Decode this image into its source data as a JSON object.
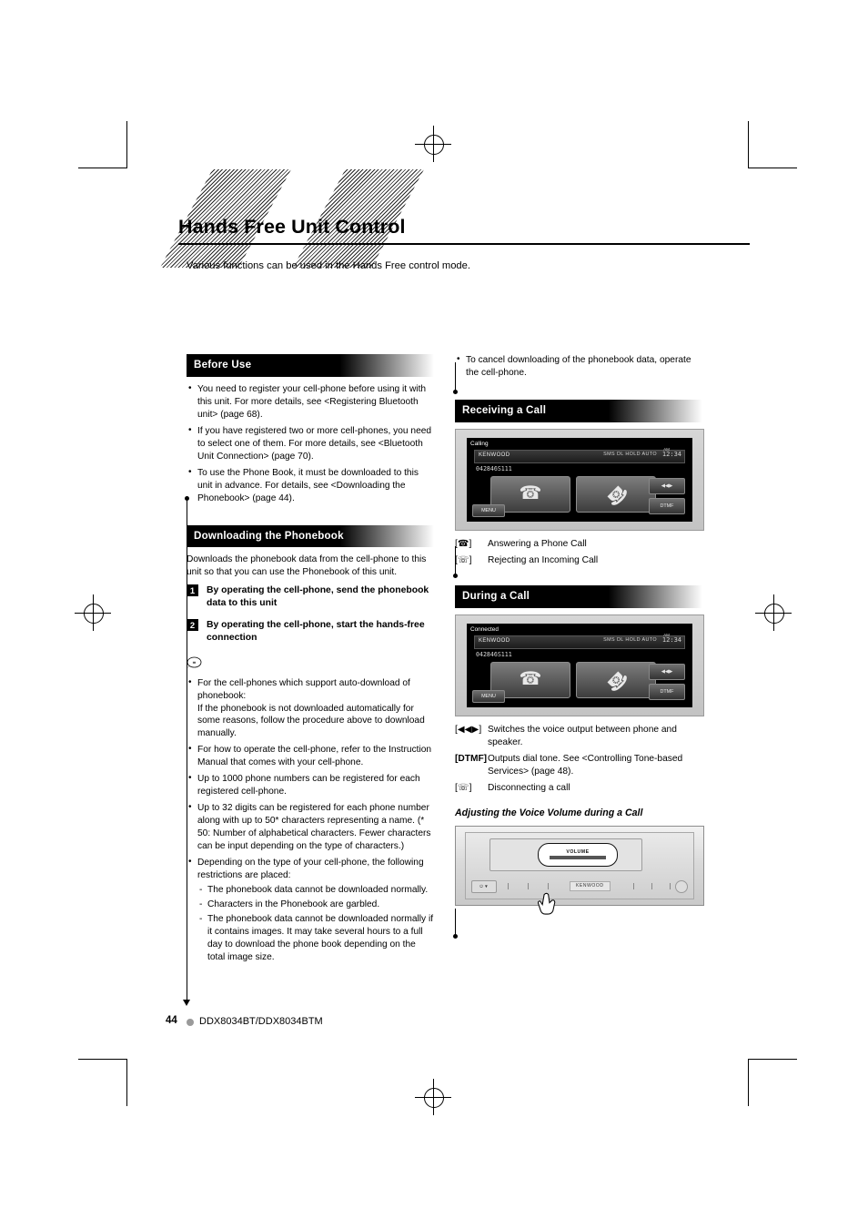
{
  "document": {
    "title": "Hands Free Unit Control",
    "subtitle": "Various functions can be used in the Hands Free control mode.",
    "footer_page": "44",
    "footer_model": "DDX8034BT/DDX8034BTM"
  },
  "sections": {
    "before_use": {
      "heading": "Before Use",
      "bullets": [
        "You need to register your cell-phone before using it with this unit. For more details, see <Registering Bluetooth unit> (page 68).",
        "If you have registered two or more cell-phones, you need to select one of them. For more details, see <Bluetooth Unit Connection> (page 70).",
        "To use the Phone Book, it must be downloaded to this unit in advance. For details, see <Downloading the Phonebook> (page 44)."
      ]
    },
    "downloading_phonebook": {
      "heading": "Downloading the Phonebook",
      "intro": "Downloads the phonebook data from the cell-phone to this unit so that you can use the Phonebook of this unit.",
      "steps": [
        {
          "num": "1",
          "text": "By operating the cell-phone, send the phonebook data to this unit"
        },
        {
          "num": "2",
          "text": "By operating the cell-phone, start the hands-free connection"
        }
      ],
      "note_bullets": [
        "For the cell-phones which support auto-download of phonebook:\nIf the phonebook is not downloaded automatically for some reasons, follow the procedure above to download manually.",
        "For how to operate the cell-phone, refer to the Instruction Manual that comes with your cell-phone.",
        "Up to 1000 phone numbers can be registered for each registered cell-phone.",
        "Up to 32 digits can be registered for each phone number along with up to 50* characters representing a name. (* 50: Number of alphabetical characters. Fewer characters can be input depending on the type of characters.)",
        "Depending on the type of your cell-phone, the following restrictions are placed:"
      ],
      "note_sub": [
        "The phonebook data cannot be downloaded normally.",
        "Characters in the Phonebook are garbled.",
        "The phonebook data cannot be downloaded normally if it contains images. It may take several hours to a full day to download the phone book depending on the total image size."
      ],
      "right_top_bullet": "To cancel downloading of the phonebook data, operate the cell-phone."
    },
    "receiving_call": {
      "heading": "Receiving a Call",
      "screen": {
        "status_label": "Calling",
        "brand": "KENWOOD",
        "icons": "SMS DL HOLD AUTO",
        "clock": "12:34",
        "am": "AM",
        "number": "042846S111",
        "menu_label": "MENU",
        "dtmf_label": "DTMF",
        "answer_icon": "phone-handset-icon",
        "reject_icon": "phone-hangup-icon"
      },
      "legend": [
        {
          "key": "phone-handset-icon",
          "text": "Answering a Phone Call"
        },
        {
          "key": "phone-hangup-icon",
          "text": "Rejecting an Incoming Call"
        }
      ]
    },
    "during_call": {
      "heading": "During a Call",
      "screen": {
        "status_label": "Connected",
        "brand": "KENWOOD",
        "icons": "SMS DL HOLD AUTO",
        "clock": "12:34",
        "am": "AM",
        "number": "042846S111",
        "menu_label": "MENU",
        "dtmf_label": "DTMF",
        "answer_icon": "phone-handset-icon",
        "reject_icon": "phone-hangup-icon"
      },
      "legend": [
        {
          "key": "voice-output-switch-icon",
          "text": "Switches the voice output between phone and speaker."
        },
        {
          "key": "DTMF",
          "text": "Outputs dial tone.  See <Controlling Tone-based Services> (page 48)."
        },
        {
          "key": "phone-hangup-icon",
          "text": "Disconnecting a call"
        }
      ],
      "subheading": "Adjusting the Voice Volume during a Call",
      "faceplate": {
        "bubble_label": "VOLUME",
        "brand": "KENWOOD"
      }
    }
  }
}
